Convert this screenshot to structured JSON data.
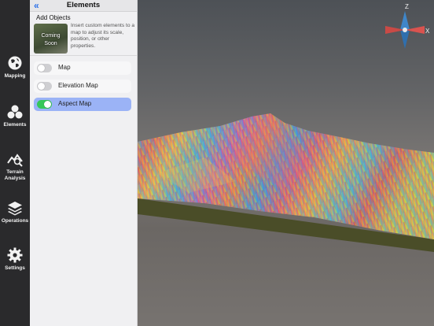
{
  "rail": {
    "items": [
      {
        "label": "Mapping",
        "icon": "globe-icon"
      },
      {
        "label": "Elements",
        "icon": "elements-icon",
        "selected": true
      },
      {
        "label": "Terrain\nAnalysis",
        "icon": "terrain-analysis-icon"
      },
      {
        "label": "Operations",
        "icon": "layers-icon"
      },
      {
        "label": "Settings",
        "icon": "gear-icon"
      }
    ]
  },
  "panel": {
    "back_glyph": "«",
    "title": "Elements",
    "add_objects": {
      "title": "Add Objects",
      "thumbnail_text": "Coming\nSoon",
      "description": "Insert custom elements to a map to adjust its scale, position, or other properties."
    },
    "toggles": [
      {
        "label": "Map",
        "on": false
      },
      {
        "label": "Elevation Map",
        "on": false
      },
      {
        "label": "Aspect Map",
        "on": true
      }
    ]
  },
  "compass": {
    "z_label": "Z",
    "x_label": "X",
    "z_color": "#3f86c9",
    "x_color": "#d9534f"
  },
  "colors": {
    "accent": "#2a6fe8",
    "toggle_on": "#35c759",
    "active_row": "#9bb3f6"
  }
}
